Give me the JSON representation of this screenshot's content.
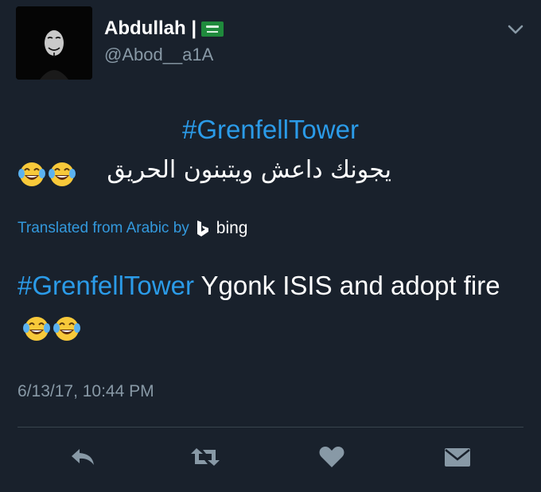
{
  "user": {
    "display_name": "Abdullah |",
    "handle": "@Abod__a1A",
    "avatar_icon": "anonymous-mask-avatar",
    "flag_icon": "saudi-flag-icon"
  },
  "tweet": {
    "hashtag": "#GrenfellTower",
    "arabic_text": "يجونك داعش ويتبنون الحريق",
    "translated_label": "Translated from Arabic by",
    "translator_name": "bing",
    "translation_hashtag": "#GrenfellTower",
    "translation_text": " Ygonk ISIS and adopt fire",
    "timestamp": "6/13/17, 10:44 PM"
  },
  "actions": {
    "reply_icon": "reply-icon",
    "retweet_icon": "retweet-icon",
    "like_icon": "heart-icon",
    "dm_icon": "envelope-icon"
  },
  "colors": {
    "background": "#19212c",
    "link": "#2b9be8",
    "muted": "#8899a6",
    "icon": "#8899a6"
  }
}
